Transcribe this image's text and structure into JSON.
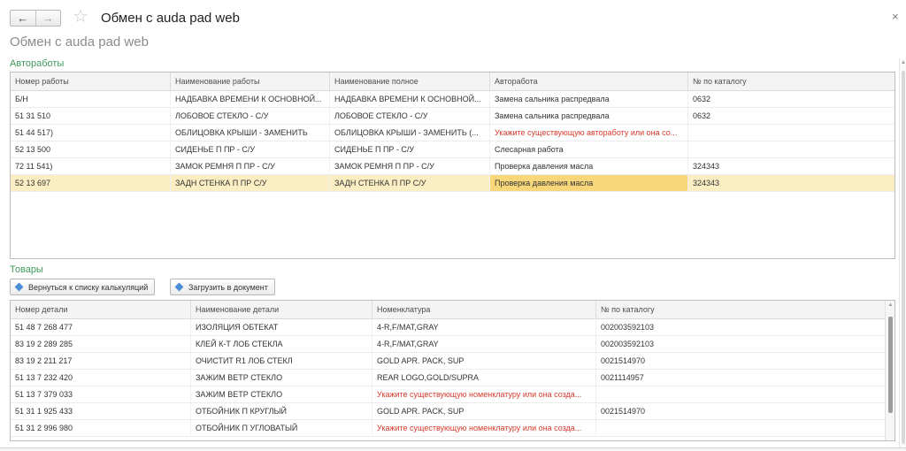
{
  "window": {
    "title": "Обмен с auda pad web",
    "back_icon": "arrow-left-icon",
    "forward_icon": "arrow-right-icon",
    "favorite_icon": "star-icon",
    "close_icon": "close-icon"
  },
  "form": {
    "title": "Обмен с auda pad web"
  },
  "autoworks": {
    "section_label": "Автоработы",
    "columns": [
      "Номер работы",
      "Наименование работы",
      "Наименование полное",
      "Авторабота",
      "№ по каталогу"
    ],
    "rows": [
      {
        "cells": [
          "Б/Н",
          "НАДБАВКА ВРЕМЕНИ К ОСНОВНОЙ...",
          "НАДБАВКА ВРЕМЕНИ К ОСНОВНОЙ...",
          "Замена сальника распредвала",
          "0632"
        ],
        "error_col": -1,
        "selected": false
      },
      {
        "cells": [
          "51 31 510",
          "ЛОБОВОЕ СТЕКЛО - С/У",
          "ЛОБОВОЕ СТЕКЛО - С/У",
          "Замена сальника распредвала",
          "0632"
        ],
        "error_col": -1,
        "selected": false
      },
      {
        "cells": [
          "51 44 517)",
          "ОБЛИЦОВКА КРЫШИ - ЗАМЕНИТЬ",
          "ОБЛИЦОВКА КРЫШИ - ЗАМЕНИТЬ (...",
          "Укажите существующую автоработу или она со...",
          ""
        ],
        "error_col": 3,
        "selected": false
      },
      {
        "cells": [
          "52 13 500",
          "СИДЕНЬЕ П ПР - С/У",
          "СИДЕНЬЕ П ПР - С/У",
          "Слесарная работа",
          ""
        ],
        "error_col": -1,
        "selected": false
      },
      {
        "cells": [
          "72 11 541)",
          "ЗАМОК РЕМНЯ П ПР - С/У",
          "ЗАМОК РЕМНЯ П ПР - С/У",
          "Проверка давления масла",
          "324343"
        ],
        "error_col": -1,
        "selected": false
      },
      {
        "cells": [
          "52 13 697",
          "ЗАДН СТЕНКА П ПР С/У",
          "ЗАДН СТЕНКА П ПР С/У",
          "Проверка давления масла",
          "324343"
        ],
        "error_col": -1,
        "selected": true,
        "highlight_col": 3
      }
    ]
  },
  "goods": {
    "section_label": "Товары",
    "buttons": [
      {
        "label": "Вернуться к списку калькуляций",
        "icon": "diamond-icon"
      },
      {
        "label": "Загрузить в документ",
        "icon": "diamond-icon"
      }
    ],
    "columns": [
      "Номер детали",
      "Наименование детали",
      "Номенклатура",
      "№ по каталогу"
    ],
    "rows": [
      {
        "cells": [
          "51 48 7 268 477",
          "ИЗОЛЯЦИЯ ОБТЕКАТ",
          "4-R,F/MAT,GRAY",
          "002003592103"
        ],
        "error_col": -1
      },
      {
        "cells": [
          "83 19 2 289 285",
          "КЛЕЙ К-Т ЛОБ СТЕКЛА",
          "4-R,F/MAT,GRAY",
          "002003592103"
        ],
        "error_col": -1
      },
      {
        "cells": [
          "83 19 2 211 217",
          "ОЧИСТИТ R1 ЛОБ СТЕКЛ",
          "GOLD APR. PACK,  SUP",
          "0021514970"
        ],
        "error_col": -1
      },
      {
        "cells": [
          "51 13 7 232 420",
          "ЗАЖИМ ВЕТР СТЕКЛО",
          "REAR LOGO,GOLD/SUPRA",
          "0021114957"
        ],
        "error_col": -1
      },
      {
        "cells": [
          "51 13 7 379 033",
          "ЗАЖИМ ВЕТР СТЕКЛО",
          "Укажите существующую номенклатуру или она созда...",
          ""
        ],
        "error_col": 2
      },
      {
        "cells": [
          "51 31 1 925 433",
          "ОТБОЙНИК П КРУГЛЫЙ",
          "GOLD APR. PACK,  SUP",
          "0021514970"
        ],
        "error_col": -1
      },
      {
        "cells": [
          "51 31 2 996 980",
          "ОТБОЙНИК П УГЛОВАТЫЙ",
          "Укажите существующую номенклатуру или она созда...",
          ""
        ],
        "error_col": 2
      }
    ],
    "scroll_fraction": 0.76
  },
  "colors": {
    "section": "#3c9a59",
    "error": "#d53a2b",
    "selected_row": "#fbeec3",
    "selected_cell": "#f7d77a",
    "button_icon": "#4d8fd6"
  }
}
